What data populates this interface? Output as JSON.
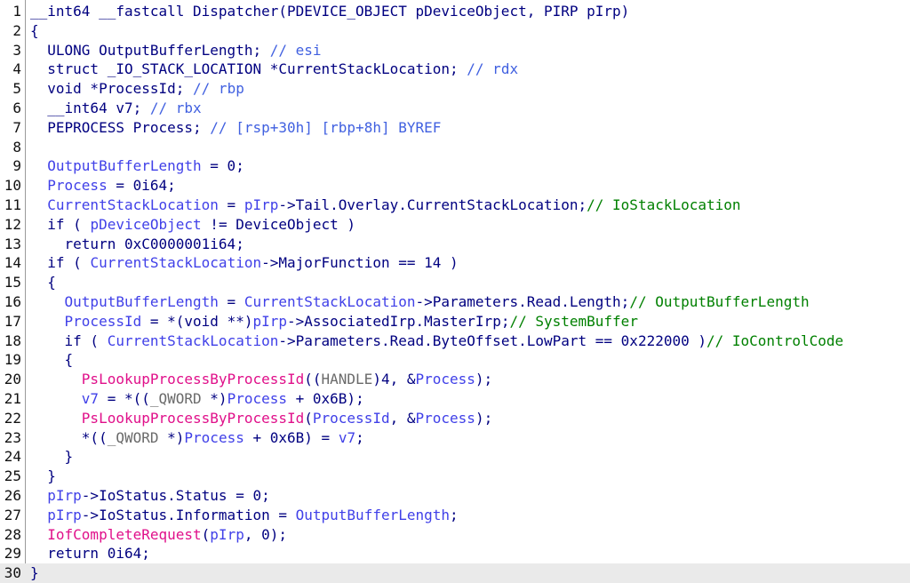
{
  "editor": {
    "current_line": 30,
    "lines": [
      {
        "n": "1",
        "tokens": [
          {
            "t": "__int64 __fastcall Dispatcher(PDEVICE_OBJECT pDeviceObject, PIRP pIrp)",
            "c": "k"
          }
        ]
      },
      {
        "n": "2",
        "tokens": [
          {
            "t": "{",
            "c": "k"
          }
        ]
      },
      {
        "n": "3",
        "tokens": [
          {
            "t": "  ULONG OutputBufferLength; ",
            "c": "k"
          },
          {
            "t": "// esi",
            "c": "c"
          }
        ]
      },
      {
        "n": "4",
        "tokens": [
          {
            "t": "  struct _IO_STACK_LOCATION *CurrentStackLocation; ",
            "c": "k"
          },
          {
            "t": "// rdx",
            "c": "c"
          }
        ]
      },
      {
        "n": "5",
        "tokens": [
          {
            "t": "  void *ProcessId; ",
            "c": "k"
          },
          {
            "t": "// rbp",
            "c": "c"
          }
        ]
      },
      {
        "n": "6",
        "tokens": [
          {
            "t": "  __int64 v7; ",
            "c": "k"
          },
          {
            "t": "// rbx",
            "c": "c"
          }
        ]
      },
      {
        "n": "7",
        "tokens": [
          {
            "t": "  PEPROCESS Process; ",
            "c": "k"
          },
          {
            "t": "// [rsp+30h] [rbp+8h] BYREF",
            "c": "c"
          }
        ]
      },
      {
        "n": "8",
        "tokens": []
      },
      {
        "n": "9",
        "tokens": [
          {
            "t": "  ",
            "c": "k"
          },
          {
            "t": "OutputBufferLength",
            "c": "v"
          },
          {
            "t": " = 0;",
            "c": "k"
          }
        ]
      },
      {
        "n": "10",
        "tokens": [
          {
            "t": "  ",
            "c": "k"
          },
          {
            "t": "Process",
            "c": "v"
          },
          {
            "t": " = 0i64;",
            "c": "k"
          }
        ]
      },
      {
        "n": "11",
        "tokens": [
          {
            "t": "  ",
            "c": "k"
          },
          {
            "t": "CurrentStackLocation",
            "c": "v"
          },
          {
            "t": " = ",
            "c": "k"
          },
          {
            "t": "pIrp",
            "c": "v"
          },
          {
            "t": "->Tail.Overlay.CurrentStackLocation;",
            "c": "k"
          },
          {
            "t": "// IoStackLocation",
            "c": "g"
          }
        ]
      },
      {
        "n": "12",
        "tokens": [
          {
            "t": "  if ( ",
            "c": "k"
          },
          {
            "t": "pDeviceObject",
            "c": "v"
          },
          {
            "t": " != DeviceObject )",
            "c": "k"
          }
        ]
      },
      {
        "n": "13",
        "tokens": [
          {
            "t": "    return 0xC0000001i64;",
            "c": "k"
          }
        ]
      },
      {
        "n": "14",
        "tokens": [
          {
            "t": "  if ( ",
            "c": "k"
          },
          {
            "t": "CurrentStackLocation",
            "c": "v"
          },
          {
            "t": "->MajorFunction == 14 )",
            "c": "k"
          }
        ]
      },
      {
        "n": "15",
        "tokens": [
          {
            "t": "  {",
            "c": "k"
          }
        ]
      },
      {
        "n": "16",
        "tokens": [
          {
            "t": "    ",
            "c": "k"
          },
          {
            "t": "OutputBufferLength",
            "c": "v"
          },
          {
            "t": " = ",
            "c": "k"
          },
          {
            "t": "CurrentStackLocation",
            "c": "v"
          },
          {
            "t": "->Parameters.Read.Length;",
            "c": "k"
          },
          {
            "t": "// OutputBufferLength",
            "c": "g"
          }
        ]
      },
      {
        "n": "17",
        "tokens": [
          {
            "t": "    ",
            "c": "k"
          },
          {
            "t": "ProcessId",
            "c": "v"
          },
          {
            "t": " = *(void **)",
            "c": "k"
          },
          {
            "t": "pIrp",
            "c": "v"
          },
          {
            "t": "->AssociatedIrp.MasterIrp;",
            "c": "k"
          },
          {
            "t": "// SystemBuffer",
            "c": "g"
          }
        ]
      },
      {
        "n": "18",
        "tokens": [
          {
            "t": "    if ( ",
            "c": "k"
          },
          {
            "t": "CurrentStackLocation",
            "c": "v"
          },
          {
            "t": "->Parameters.Read.ByteOffset.LowPart == 0x222000 )",
            "c": "k"
          },
          {
            "t": "// IoControlCode",
            "c": "g"
          }
        ]
      },
      {
        "n": "19",
        "tokens": [
          {
            "t": "    {",
            "c": "k"
          }
        ]
      },
      {
        "n": "20",
        "tokens": [
          {
            "t": "      ",
            "c": "k"
          },
          {
            "t": "PsLookupProcessByProcessId",
            "c": "f"
          },
          {
            "t": "((",
            "c": "k"
          },
          {
            "t": "HANDLE",
            "c": "p"
          },
          {
            "t": ")4, &",
            "c": "k"
          },
          {
            "t": "Process",
            "c": "v"
          },
          {
            "t": ");",
            "c": "k"
          }
        ]
      },
      {
        "n": "21",
        "tokens": [
          {
            "t": "      ",
            "c": "k"
          },
          {
            "t": "v7",
            "c": "v"
          },
          {
            "t": " = *((",
            "c": "k"
          },
          {
            "t": "_QWORD",
            "c": "p"
          },
          {
            "t": " *)",
            "c": "k"
          },
          {
            "t": "Process",
            "c": "v"
          },
          {
            "t": " + 0x6B);",
            "c": "k"
          }
        ]
      },
      {
        "n": "22",
        "tokens": [
          {
            "t": "      ",
            "c": "k"
          },
          {
            "t": "PsLookupProcessByProcessId",
            "c": "f"
          },
          {
            "t": "(",
            "c": "k"
          },
          {
            "t": "ProcessId",
            "c": "v"
          },
          {
            "t": ", &",
            "c": "k"
          },
          {
            "t": "Process",
            "c": "v"
          },
          {
            "t": ");",
            "c": "k"
          }
        ]
      },
      {
        "n": "23",
        "tokens": [
          {
            "t": "      *((",
            "c": "k"
          },
          {
            "t": "_QWORD",
            "c": "p"
          },
          {
            "t": " *)",
            "c": "k"
          },
          {
            "t": "Process",
            "c": "v"
          },
          {
            "t": " + 0x6B) = ",
            "c": "k"
          },
          {
            "t": "v7",
            "c": "v"
          },
          {
            "t": ";",
            "c": "k"
          }
        ]
      },
      {
        "n": "24",
        "tokens": [
          {
            "t": "    }",
            "c": "k"
          }
        ]
      },
      {
        "n": "25",
        "tokens": [
          {
            "t": "  }",
            "c": "k"
          }
        ]
      },
      {
        "n": "26",
        "tokens": [
          {
            "t": "  ",
            "c": "k"
          },
          {
            "t": "pIrp",
            "c": "v"
          },
          {
            "t": "->IoStatus.Status = 0;",
            "c": "k"
          }
        ]
      },
      {
        "n": "27",
        "tokens": [
          {
            "t": "  ",
            "c": "k"
          },
          {
            "t": "pIrp",
            "c": "v"
          },
          {
            "t": "->IoStatus.Information = ",
            "c": "k"
          },
          {
            "t": "OutputBufferLength",
            "c": "v"
          },
          {
            "t": ";",
            "c": "k"
          }
        ]
      },
      {
        "n": "28",
        "tokens": [
          {
            "t": "  ",
            "c": "k"
          },
          {
            "t": "IofCompleteRequest",
            "c": "f"
          },
          {
            "t": "(",
            "c": "k"
          },
          {
            "t": "pIrp",
            "c": "v"
          },
          {
            "t": ", 0);",
            "c": "k"
          }
        ]
      },
      {
        "n": "29",
        "tokens": [
          {
            "t": "  return 0i64;",
            "c": "k"
          }
        ]
      },
      {
        "n": "30",
        "tokens": [
          {
            "t": "}",
            "c": "k"
          }
        ]
      }
    ]
  },
  "colors": {
    "keyword": "#000080",
    "variable": "#4040e8",
    "comment": "#4060e0",
    "comment_green": "#008000",
    "function": "#e0108a",
    "type": "#6a6a6a",
    "current_line_bg": "#eaeaea"
  }
}
